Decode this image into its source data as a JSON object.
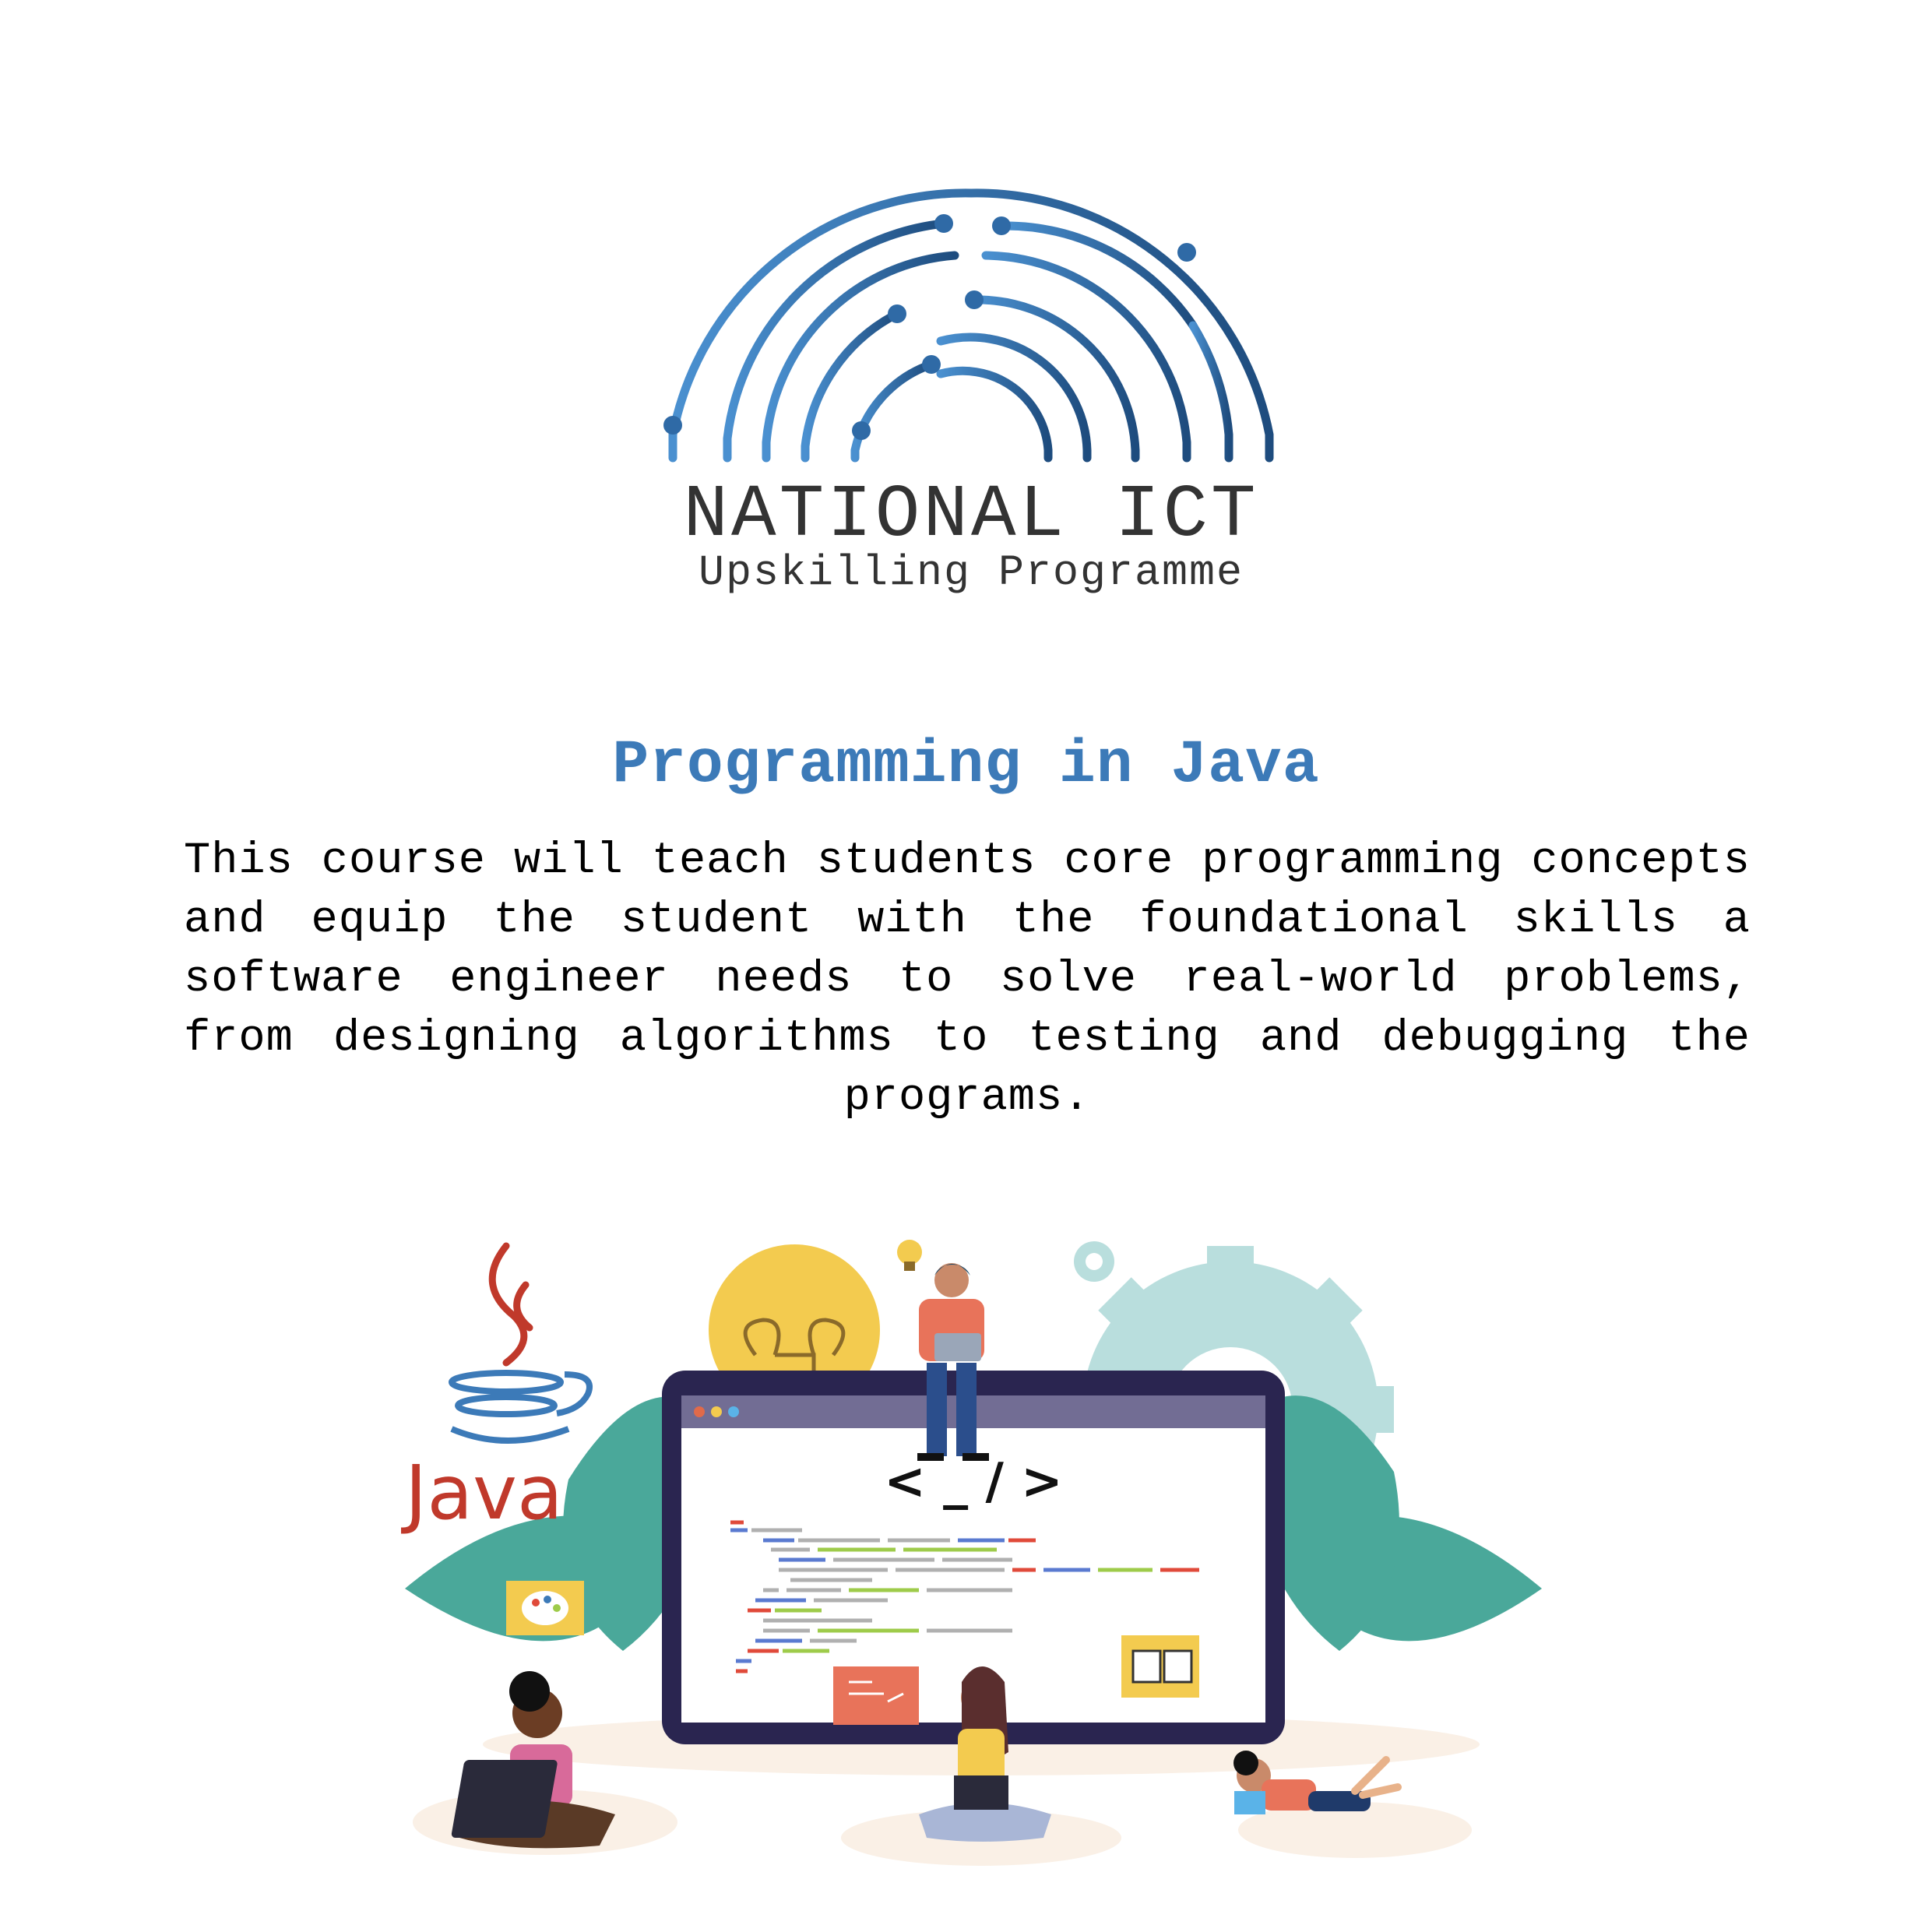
{
  "logo": {
    "org_name": "NATIONAL ICT",
    "org_subtitle": "Upskilling Programme",
    "colors": {
      "arc_light": "#3f86c8",
      "arc_dark": "#1f4f82",
      "text": "#333333"
    }
  },
  "course": {
    "title": "Programming in Java",
    "description": "This course will teach students core programming concepts and equip the student with the foundational skills a software engineer needs to solve real-world problems, from designing algorithms to testing and debugging the programs."
  },
  "illustration": {
    "brand_logo_text": "Java",
    "code_tag": "< _ / >",
    "icons": [
      "java-cup-icon",
      "lightbulb-icon",
      "gear-icon",
      "palette-icon",
      "book-icon",
      "whiteboard-icon"
    ],
    "colors": {
      "accent_blue": "#3c7ab8",
      "java_red": "#c0392b",
      "leaf": "#4aa89a",
      "gear": "#b9dedd",
      "bulb": "#f3cb4f",
      "screen_frame": "#2a2550"
    }
  }
}
